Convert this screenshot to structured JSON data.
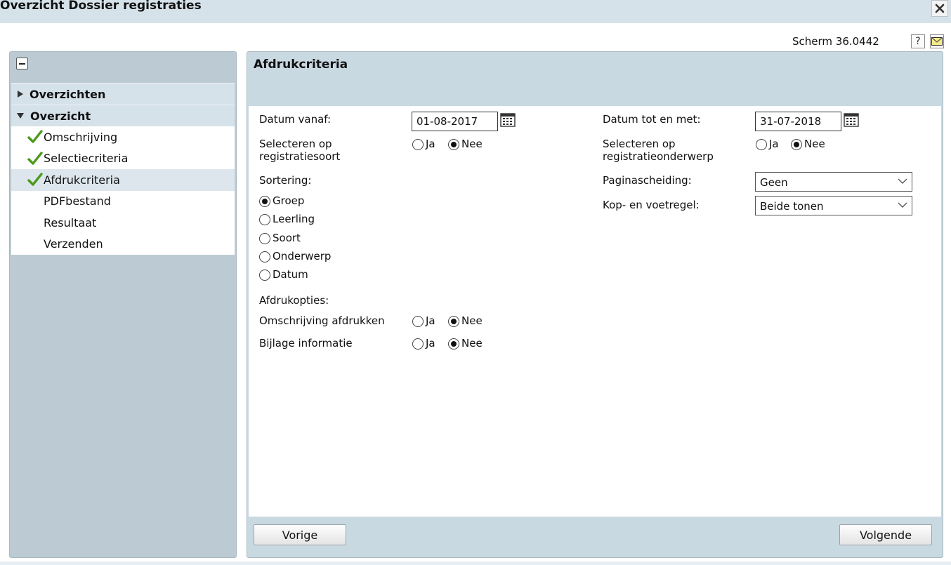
{
  "window": {
    "title": "Overzicht Dossier registraties",
    "close_label": "✕",
    "screen_code": "Scherm 36.0442",
    "help_label": "?"
  },
  "sidebar": {
    "groups": [
      {
        "label": "Overzichten",
        "expanded": false
      },
      {
        "label": "Overzicht",
        "expanded": true
      }
    ],
    "items": [
      {
        "label": "Omschrijving",
        "checked": true
      },
      {
        "label": "Selectiecriteria",
        "checked": true
      },
      {
        "label": "Afdrukcriteria",
        "checked": true,
        "active": true
      },
      {
        "label": "PDFbestand",
        "checked": false
      },
      {
        "label": "Resultaat",
        "checked": false
      },
      {
        "label": "Verzenden",
        "checked": false
      }
    ]
  },
  "main": {
    "header": "Afdrukcriteria",
    "left": {
      "datum_vanaf_label": "Datum vanaf:",
      "datum_vanaf_value": "01-08-2017",
      "sel_soort_label_1": "Selecteren op",
      "sel_soort_label_2": "registratiesoort",
      "sortering_label": "Sortering:",
      "sort_options": [
        "Groep",
        "Leerling",
        "Soort",
        "Onderwerp",
        "Datum"
      ],
      "sort_selected": "Groep",
      "afdrukopties_label": "Afdrukopties:",
      "omschrijving_label": "Omschrijving afdrukken",
      "bijlage_label": "Bijlage informatie"
    },
    "right": {
      "datum_tot_label": "Datum tot en met:",
      "datum_tot_value": "31-07-2018",
      "sel_onderwerp_label_1": "Selecteren op",
      "sel_onderwerp_label_2": "registratieonderwerp",
      "paginascheiding_label": "Paginascheiding:",
      "paginascheiding_value": "Geen",
      "kop_label": "Kop- en voetregel:",
      "kop_value": "Beide tonen"
    },
    "yes_label": "Ja",
    "no_label": "Nee",
    "prev_button": "Vorige",
    "next_button": "Volgende"
  },
  "colors": {
    "header_bg": "#d6e2ea",
    "sidebar_bg": "#bccbd3",
    "check_green": "#4a9a1c"
  }
}
